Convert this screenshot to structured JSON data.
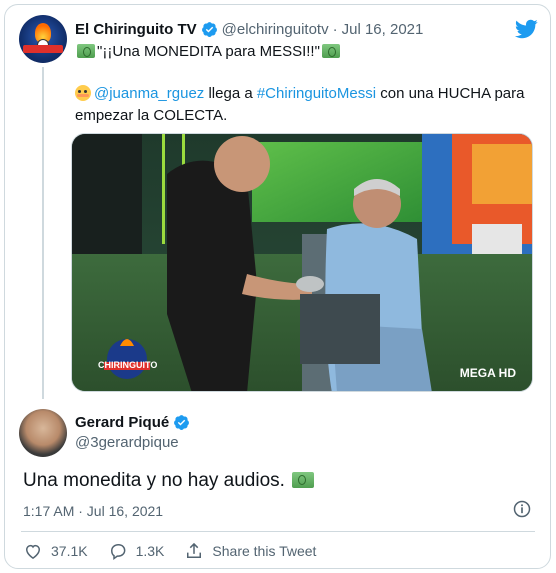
{
  "colors": {
    "link": "#1b95e0",
    "twitter_blue": "#1d9bf0",
    "secondary_text": "#536471",
    "border": "#cfd9de"
  },
  "quoted_tweet": {
    "author_name": "El Chiringuito TV",
    "handle": "@elchiringuitotv",
    "separator": "·",
    "date": "Jul 16, 2021",
    "quote_text": "\"¡¡Una MONEDITA para MESSI!!\"",
    "mention": "@juanma_rguez",
    "text_part1": "llega a",
    "hashtag": "#ChiringuitoMessi",
    "text_part2": "con una HUCHA para empezar la COLECTA.",
    "media_watermark_left": "CHIRINGUITO",
    "media_watermark_right": "MEGA HD"
  },
  "tweet": {
    "author_name": "Gerard Piqué",
    "handle": "@3gerardpique",
    "text": "Una monedita y no hay audios.",
    "timestamp": "1:17 AM · Jul 16, 2021",
    "likes": "37.1K",
    "replies": "1.3K",
    "share_label": "Share this Tweet"
  },
  "icons": [
    "twitter-bird-icon",
    "verified-icon",
    "info-icon",
    "heart-icon",
    "reply-icon",
    "share-icon",
    "money-emoji-icon",
    "flushed-emoji-icon"
  ]
}
